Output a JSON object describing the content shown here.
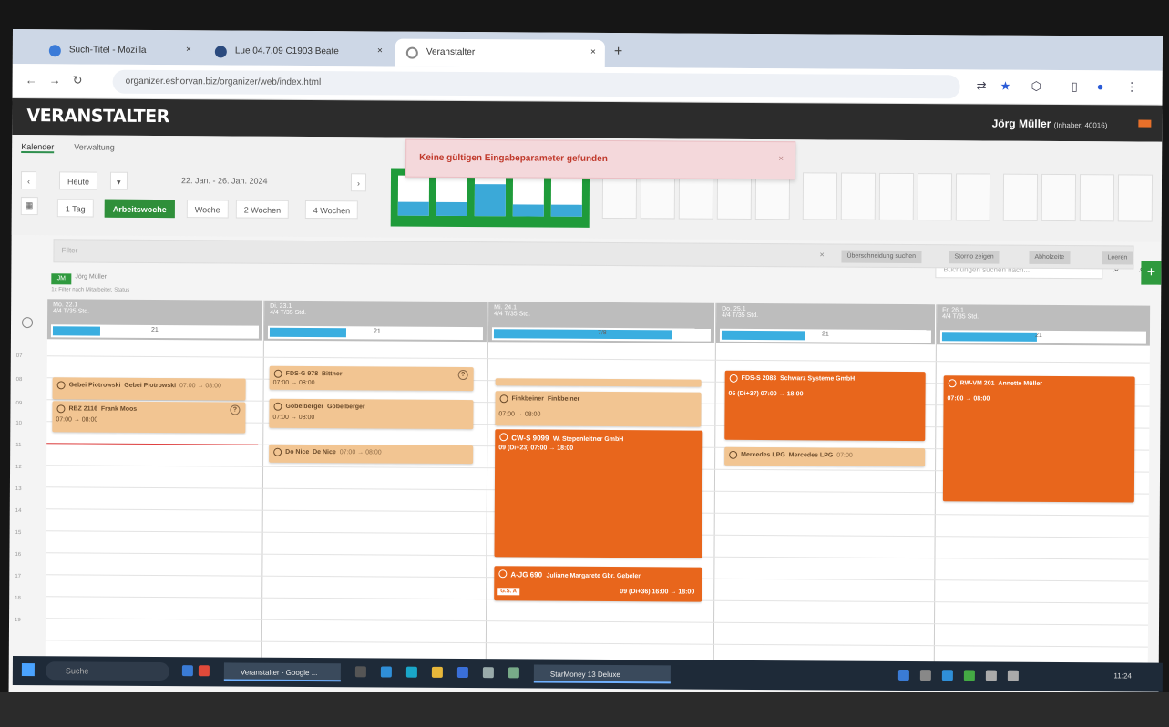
{
  "browser": {
    "tabs": [
      {
        "label": "Such-Titel - Mozilla"
      },
      {
        "label": "Lue 04.7.09 C1903 Beate"
      },
      {
        "label": "Veranstalter"
      }
    ],
    "url": "organizer.eshorvan.biz/organizer/web/index.html"
  },
  "app": {
    "brand": "VERANSTALTER",
    "user_name": "Jörg Müller",
    "user_role": "(Inhaber, 40016)"
  },
  "toolbar": {
    "subtabs": [
      "Kalender",
      "Verwaltung"
    ],
    "today_label": "Heute",
    "date_range": "22. Jan. - 26. Jan. 2024",
    "view_buttons": [
      "1 Tag",
      "Arbeitswoche",
      "Woche",
      "2 Wochen",
      "4 Wochen"
    ],
    "search_placeholder": "Buchungen suchen nach..."
  },
  "alert": {
    "message": "Keine gültigen Eingabeparameter gefunden",
    "close": "×"
  },
  "filters": {
    "placeholder": "Filter",
    "clear": "×",
    "options": [
      "Überschneidung suchen",
      "Storno zeigen",
      "Abholzeite",
      "Leeren"
    ],
    "add_label": "+"
  },
  "user_filter": {
    "chip": "JM",
    "name": "Jörg Müller",
    "note": "1x Filter nach Mitarbeiter, Status"
  },
  "calendar": {
    "days": [
      {
        "label": "Mo. 22.1",
        "sub": "4/4 T/35 Std.",
        "count": "21"
      },
      {
        "label": "Di. 23.1",
        "sub": "4/4 T/35 Std.",
        "count": "21"
      },
      {
        "label": "Mi. 24.1",
        "sub": "4/4 T/35 Std.",
        "count": "7/8"
      },
      {
        "label": "Do. 25.1",
        "sub": "4/4 T/35 Std.",
        "count": "21"
      },
      {
        "label": "Fr. 26.1",
        "sub": "4/4 T/35 Std.",
        "count": "21"
      }
    ],
    "hours": [
      "07",
      "08",
      "09",
      "10",
      "11",
      "12",
      "13",
      "14",
      "15",
      "16",
      "17",
      "18",
      "19"
    ],
    "events": {
      "mo1": {
        "title": "Gebei Piotrowski",
        "owner": "Gebei Piotrowski",
        "time": "07:00 → 08:00"
      },
      "mo2": {
        "title": "RBZ 2116",
        "owner": "Frank Moos",
        "time": "07:00 → 08:00"
      },
      "di1": {
        "title": "FDS-G 978",
        "owner": "Bittner",
        "time": "07:00 → 08:00"
      },
      "di2": {
        "title": "Gobelberger",
        "owner": "Gobelberger",
        "time": "07:00 → 08:00"
      },
      "di3": {
        "title": "Do Nice",
        "owner": "De Nice",
        "time": "07:00 → 08:00"
      },
      "mi1": {
        "title": "Finkbeiner",
        "owner": "Finkbeiner",
        "time": "07:00 → 08:00"
      },
      "mi2": {
        "title": "CW-S 9099",
        "owner": "W. Stepenleitner GmbH",
        "time": "09 (Di+23) 07:00 → 18:00"
      },
      "mi3": {
        "title": "A-JG 690",
        "owner": "Juliane Margarete Gbr. Gebeler",
        "tag": "G.S. A",
        "time": "09 (Di+36) 16:00 → 18:00"
      },
      "do1": {
        "title": "FDS-S 2083",
        "owner": "Schwarz Systeme GmbH",
        "time": "05 (Di+37) 07:00 → 18:00"
      },
      "do2": {
        "title": "Mercedes LPG",
        "owner": "Mercedes LPG",
        "time": "07:00"
      },
      "fr1": {
        "title": "RW-VM 201",
        "owner": "Annette Müller",
        "time": "07:00 → 08:00"
      }
    }
  },
  "taskbar": {
    "search": "Suche",
    "apps": [
      "Veranstalter - Google ...",
      "StarMoney 13 Deluxe"
    ],
    "clock": "11:24"
  },
  "colors": {
    "accent_green": "#2f9a3e",
    "event_orange": "#e8661c",
    "event_light": "#f2c592",
    "capacity_blue": "#3aaee0"
  }
}
